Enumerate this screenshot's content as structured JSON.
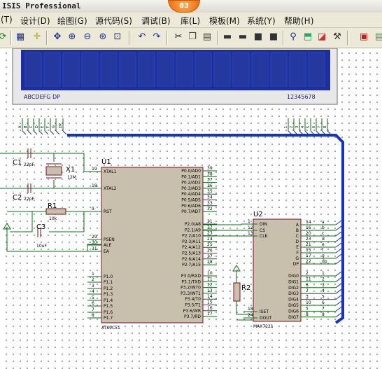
{
  "title": "ISIS Professional",
  "badge": "83",
  "menu": [
    "(T)",
    "设计(D)",
    "绘图(G)",
    "源代码(S)",
    "调试(B)",
    "库(L)",
    "模板(M)",
    "系统(Y)",
    "帮助(H)"
  ],
  "toolbar_icons": [
    "refresh-icon",
    "grid-icon",
    "origin-icon",
    "pan-icon",
    "zoom-in-icon",
    "zoom-out-icon",
    "zoom-all-icon",
    "zoom-area-icon",
    "undo-icon",
    "redo-icon",
    "cut-icon",
    "copy-icon",
    "paste-icon",
    "block-copy-icon",
    "block-move-icon",
    "block-rotate-icon",
    "block-delete-icon",
    "pick-device-icon",
    "make-device-icon",
    "package-tool-icon",
    "decompose-icon",
    "wire-autoroute-icon",
    "search-tag-icon",
    "property-tool-icon",
    "design-explorer-icon",
    "new-sheet-icon"
  ],
  "lcd": {
    "left_label": "ABCDEFG DP",
    "right_label": "12345678",
    "left_pins": [
      "A",
      "B",
      "C",
      "D",
      "E",
      "F",
      "G",
      "DP"
    ],
    "right_pins": [
      "1",
      "2",
      "3",
      "4",
      "5",
      "6",
      "7",
      "8"
    ]
  },
  "components": {
    "c1": {
      "ref": "C1",
      "value": "22pF"
    },
    "c2": {
      "ref": "C2",
      "value": "22pF"
    },
    "c3": {
      "ref": "C3",
      "value": "10uF"
    },
    "x1": {
      "ref": "X1",
      "value": "12M"
    },
    "r1": {
      "ref": "R1",
      "value": "10k"
    },
    "r2": {
      "ref": "R2"
    },
    "u1": {
      "ref": "U1",
      "part": "AT89C51"
    },
    "u2": {
      "ref": "U2",
      "part": "MAX7221"
    }
  },
  "u1_left_pins": [
    {
      "num": "19",
      "name": "XTAL1"
    },
    {
      "num": "18",
      "name": "XTAL2"
    },
    {
      "num": "9",
      "name": "RST"
    },
    {
      "num": "29",
      "name": "PSEN"
    },
    {
      "num": "30",
      "name": "ALE"
    },
    {
      "num": "31",
      "name": "EA"
    },
    {
      "num": "1",
      "name": "P1.0"
    },
    {
      "num": "2",
      "name": "P1.1"
    },
    {
      "num": "3",
      "name": "P1.2"
    },
    {
      "num": "4",
      "name": "P1.3"
    },
    {
      "num": "5",
      "name": "P1.4"
    },
    {
      "num": "6",
      "name": "P1.5"
    },
    {
      "num": "7",
      "name": "P1.6"
    },
    {
      "num": "8",
      "name": "P1.7"
    }
  ],
  "u1_right_pins": [
    {
      "num": "39",
      "name": "P0.0/AD0"
    },
    {
      "num": "38",
      "name": "P0.1/AD1"
    },
    {
      "num": "37",
      "name": "P0.2/AD2"
    },
    {
      "num": "36",
      "name": "P0.3/AD3"
    },
    {
      "num": "35",
      "name": "P0.4/AD4"
    },
    {
      "num": "34",
      "name": "P0.5/AD5"
    },
    {
      "num": "33",
      "name": "P0.6/AD6"
    },
    {
      "num": "32",
      "name": "P0.7/AD7"
    },
    {
      "num": "21",
      "name": "P2.0/A8"
    },
    {
      "num": "22",
      "name": "P2.1/A9"
    },
    {
      "num": "23",
      "name": "P2.2/A10"
    },
    {
      "num": "24",
      "name": "P2.3/A11"
    },
    {
      "num": "25",
      "name": "P2.4/A12"
    },
    {
      "num": "26",
      "name": "P2.5/A13"
    },
    {
      "num": "27",
      "name": "P2.6/A14"
    },
    {
      "num": "28",
      "name": "P2.7/A15"
    },
    {
      "num": "10",
      "name": "P3.0/RXD"
    },
    {
      "num": "11",
      "name": "P3.1/TXD"
    },
    {
      "num": "12",
      "name": "P3.2/INT0"
    },
    {
      "num": "13",
      "name": "P3.3/INT1"
    },
    {
      "num": "14",
      "name": "P3.4/T0"
    },
    {
      "num": "15",
      "name": "P3.5/T1"
    },
    {
      "num": "16",
      "name": "P3.6/WR"
    },
    {
      "num": "17",
      "name": "P3.7/RD"
    }
  ],
  "u2_left_pins": [
    {
      "num": "1",
      "name": "DIN"
    },
    {
      "num": "12",
      "name": "CS"
    },
    {
      "num": "13",
      "name": "CLK"
    },
    {
      "num": "18",
      "name": "ISET"
    },
    {
      "num": "24",
      "name": "DOUT"
    }
  ],
  "u2_right_pins": [
    {
      "num": "14",
      "name": "A",
      "net": "a"
    },
    {
      "num": "16",
      "name": "B",
      "net": "b"
    },
    {
      "num": "20",
      "name": "C",
      "net": "c"
    },
    {
      "num": "23",
      "name": "D",
      "net": "d"
    },
    {
      "num": "21",
      "name": "E",
      "net": "e"
    },
    {
      "num": "15",
      "name": "F",
      "net": "f"
    },
    {
      "num": "17",
      "name": "G",
      "net": "g"
    },
    {
      "num": "22",
      "name": "DP",
      "net": "dp"
    },
    {
      "num": "2",
      "name": "DIG0",
      "net": "1"
    },
    {
      "num": "11",
      "name": "DIG1",
      "net": "2"
    },
    {
      "num": "6",
      "name": "DIG2",
      "net": "3"
    },
    {
      "num": "7",
      "name": "DIG3",
      "net": "4"
    },
    {
      "num": "3",
      "name": "DIG4",
      "net": "5"
    },
    {
      "num": "10",
      "name": "DIG5",
      "net": "6"
    },
    {
      "num": "5",
      "name": "DIG6",
      "net": "7"
    },
    {
      "num": "8",
      "name": "DIG7",
      "net": "8"
    }
  ],
  "colors": {
    "chip_fill": "#c8c0ad",
    "chip_stroke": "#7a1020",
    "wire": "#0b6b14",
    "bus": "#1432c8",
    "lcd_bg": "#1c2f9c",
    "text": "#000000"
  }
}
